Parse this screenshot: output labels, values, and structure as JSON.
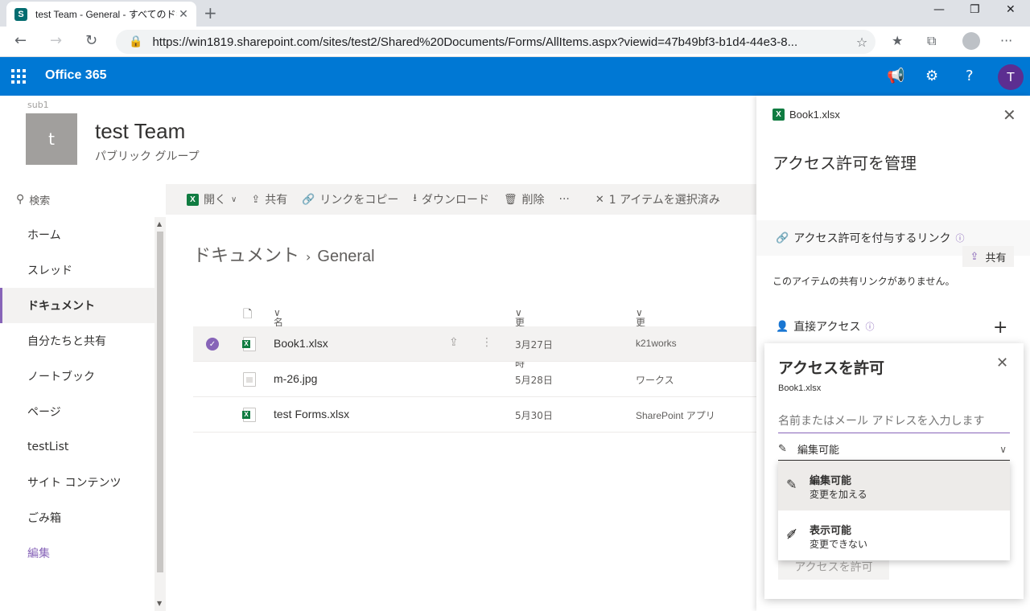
{
  "browser": {
    "tab_title": "test Team - General - すべてのドキュ",
    "favicon_letter": "S",
    "url": "https://win1819.sharepoint.com/sites/test2/Shared%20Documents/Forms/AllItems.aspx?viewid=47b49bf3-b1d4-44e3-8..."
  },
  "o365": {
    "brand": "Office 365",
    "avatar_initial": "T"
  },
  "site": {
    "path": "sub1",
    "logo_letter": "t",
    "title": "test Team",
    "subtitle": "パブリック グループ"
  },
  "search": {
    "label": "検索"
  },
  "nav": {
    "items": [
      {
        "label": "ホーム"
      },
      {
        "label": "スレッド"
      },
      {
        "label": "ドキュメント"
      },
      {
        "label": "自分たちと共有"
      },
      {
        "label": "ノートブック"
      },
      {
        "label": "ページ"
      },
      {
        "label": "testList"
      },
      {
        "label": "サイト コンテンツ"
      },
      {
        "label": "ごみ箱"
      },
      {
        "label": "編集"
      }
    ]
  },
  "commands": {
    "open": "開く",
    "share": "共有",
    "copy_link": "リンクをコピー",
    "download": "ダウンロード",
    "delete": "削除",
    "more": "···",
    "selection": "1 アイテムを選択済み"
  },
  "breadcrumb": {
    "root": "ドキュメント",
    "current": "General"
  },
  "list": {
    "headers": {
      "name": "名前",
      "modified": "更新日時",
      "modified_by": "更新者"
    },
    "rows": [
      {
        "name": "Book1.xlsx",
        "date": "3月27日",
        "by": "k21works"
      },
      {
        "name": "m-26.jpg",
        "date": "5月28日",
        "by": "ワークス"
      },
      {
        "name": "test Forms.xlsx",
        "date": "5月30日",
        "by": "SharePoint アプリ"
      }
    ]
  },
  "panel": {
    "file": "Book1.xlsx",
    "title": "アクセス許可を管理",
    "links_section": "アクセス許可を付与するリンク",
    "share_button": "共有",
    "no_links": "このアイテムの共有リンクがありません。",
    "direct_section": "直接アクセス"
  },
  "grant": {
    "title": "アクセスを許可",
    "file": "Book1.xlsx",
    "placeholder": "名前またはメール アドレスを入力します",
    "permission": "編集可能",
    "button": "アクセスを許可",
    "options": [
      {
        "label": "編集可能",
        "desc": "変更を加える"
      },
      {
        "label": "表示可能",
        "desc": "変更できない"
      }
    ]
  },
  "colors": {
    "o365_blue": "#0078d4",
    "accent_purple": "#8764b8",
    "excel_green": "#107c41"
  }
}
